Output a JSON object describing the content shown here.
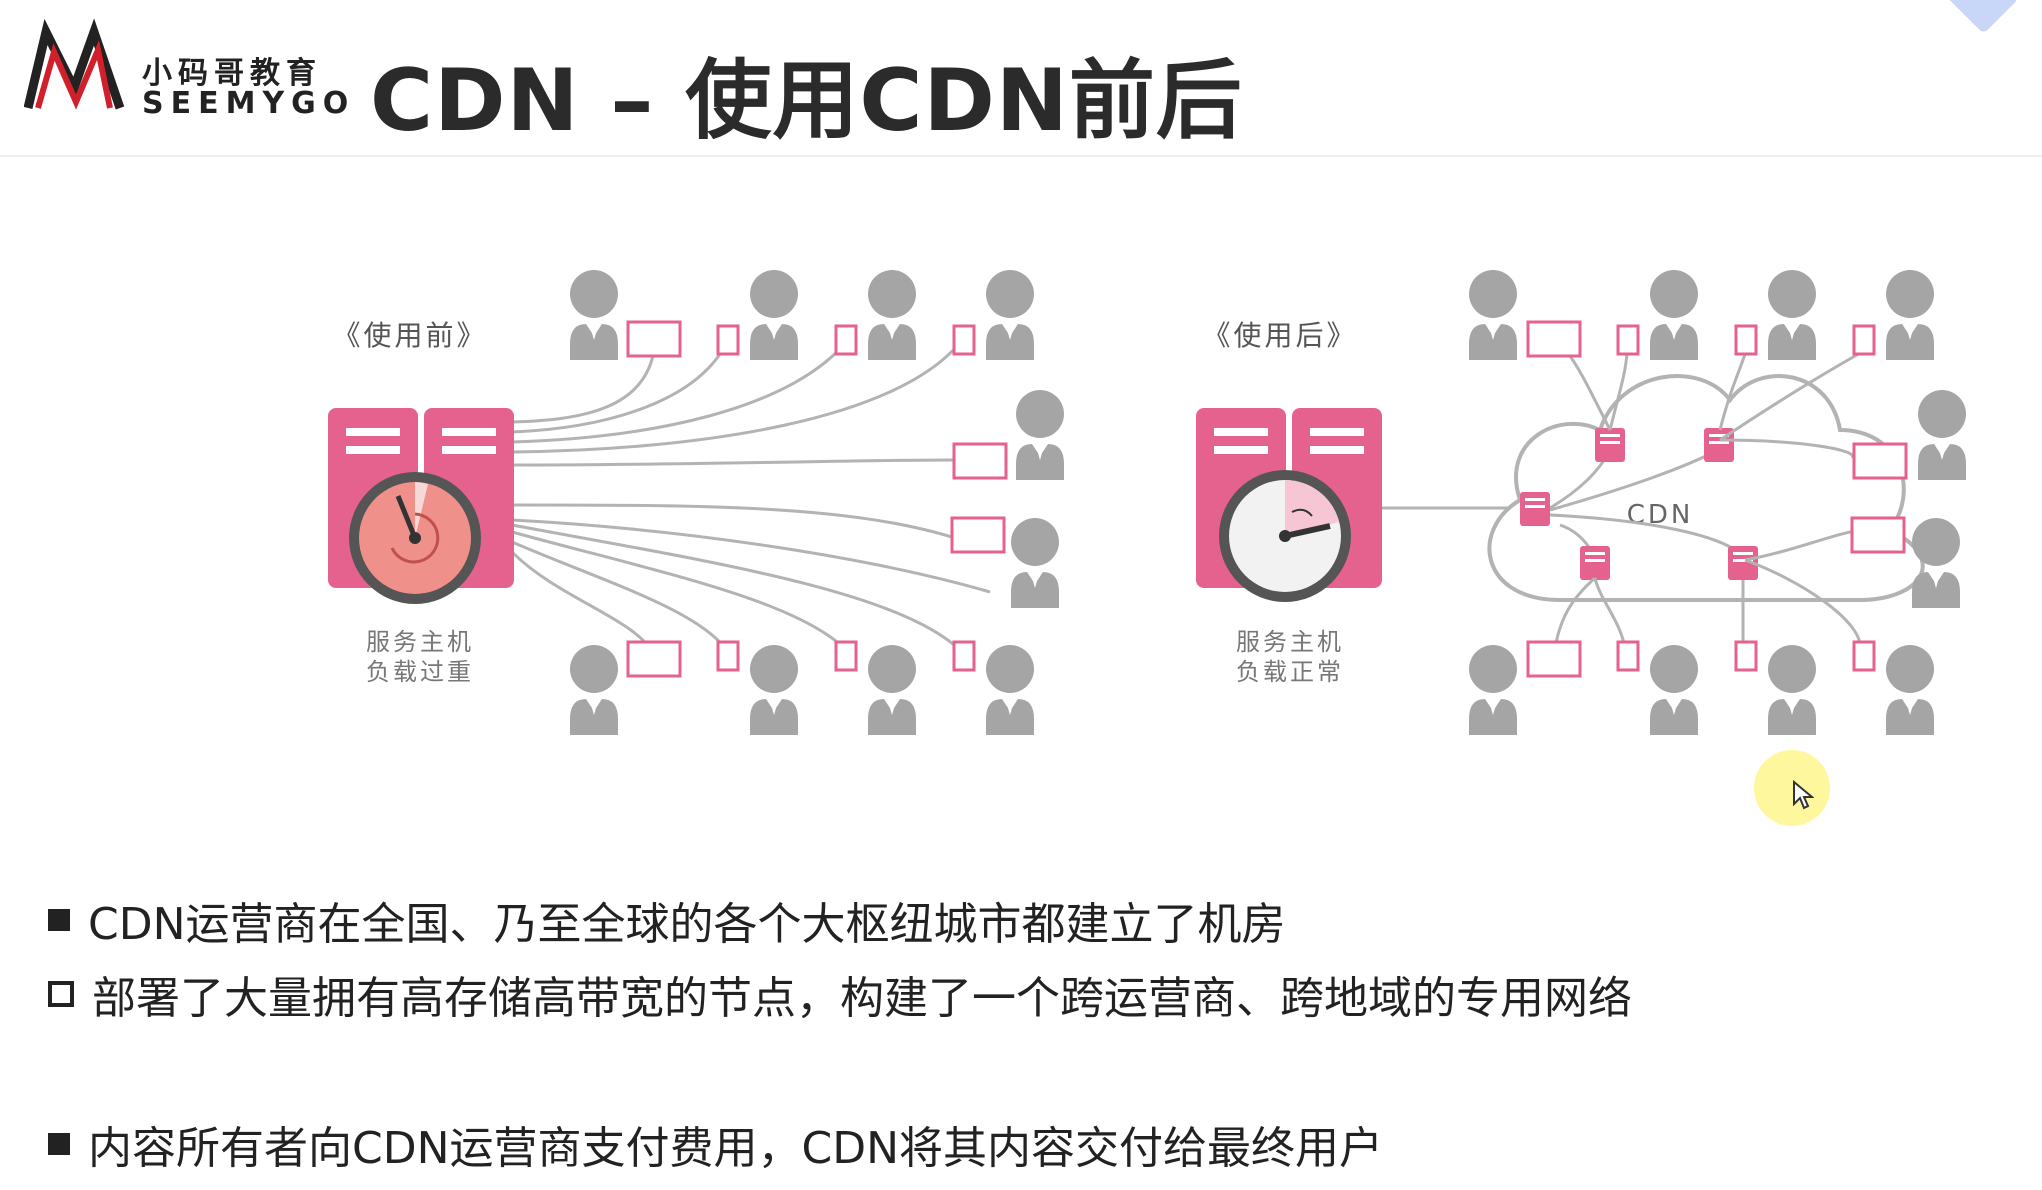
{
  "header": {
    "logo_cn": "小码哥教育",
    "logo_en": "SEEMYGO",
    "title": "CDN  –  使用CDN前后"
  },
  "diagram": {
    "before": {
      "label": "《使用前》",
      "server_status_line1": "服务主机",
      "server_status_line2": "负载过重"
    },
    "after": {
      "label": "《使用后》",
      "server_status_line1": "服务主机",
      "server_status_line2": "负载正常",
      "cloud_label": "CDN"
    },
    "colors": {
      "server_pink": "#e5628e",
      "clock_overloaded": "#f0908a",
      "clock_normal": "#f2f2f2",
      "user_gray": "#a5a5a5",
      "line_gray": "#b3b3b3",
      "packet_pink": "#e5628e"
    }
  },
  "bullets": [
    {
      "marker": "filled-square",
      "text": "CDN运营商在全国、乃至全球的各个大枢纽城市都建立了机房"
    },
    {
      "marker": "hollow-square",
      "text": "部署了大量拥有高存储高带宽的节点，构建了一个跨运营商、跨地域的专用网络"
    },
    {
      "marker": "filled-square",
      "text": "内容所有者向CDN运营商支付费用，CDN将其内容交付给最终用户"
    }
  ]
}
